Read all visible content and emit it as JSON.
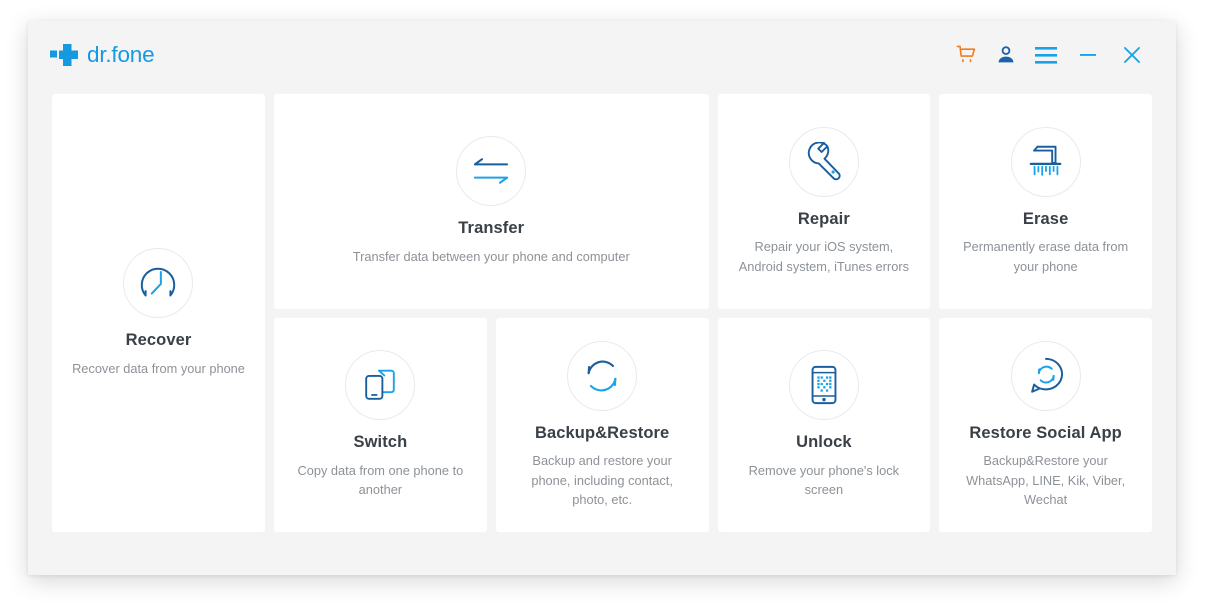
{
  "window": {
    "app_title": "dr.fone",
    "logo_icon": "dr-fone-plus-logo",
    "brand_color": "#159ae2"
  },
  "titlebar": {
    "tools": [
      {
        "name": "cart-icon",
        "label": "Shopping cart",
        "color": "#f07c1c"
      },
      {
        "name": "account-icon",
        "label": "Account",
        "color": "#1b62a8"
      },
      {
        "name": "menu-icon",
        "label": "Menu",
        "color": "#19a3e6"
      },
      {
        "name": "minimize-icon",
        "label": "Minimize",
        "color": "#19a3e6"
      },
      {
        "name": "close-icon",
        "label": "Close",
        "color": "#19a3e6"
      }
    ]
  },
  "features": {
    "recover": {
      "title": "Recover",
      "desc": "Recover data from your phone",
      "icon": "clock-recover-icon"
    },
    "transfer": {
      "title": "Transfer",
      "desc": "Transfer data between your phone and computer",
      "icon": "transfer-arrows-icon"
    },
    "repair": {
      "title": "Repair",
      "desc": "Repair your iOS system, Android system, iTunes errors",
      "icon": "wrench-icon"
    },
    "erase": {
      "title": "Erase",
      "desc": "Permanently erase data from your phone",
      "icon": "shredder-icon"
    },
    "switch": {
      "title": "Switch",
      "desc": "Copy data from one phone to another",
      "icon": "two-phones-icon"
    },
    "backup": {
      "title": "Backup&Restore",
      "desc": "Backup and restore your phone, including contact, photo, etc.",
      "icon": "circular-sync-icon"
    },
    "unlock": {
      "title": "Unlock",
      "desc": "Remove your phone's lock screen",
      "icon": "phone-lockscreen-icon"
    },
    "social": {
      "title": "Restore Social App",
      "desc": "Backup&Restore your WhatsApp, LINE, Kik, Viber, Wechat",
      "icon": "chat-bubble-sync-icon"
    }
  },
  "colors": {
    "dark_blue": "#1b5e9e",
    "light_blue": "#1aa3e8",
    "orange": "#f07c1c",
    "title_text": "#3a4047",
    "desc_text": "#8d9298",
    "window_bg": "#f4f4f4",
    "card_bg": "#ffffff"
  }
}
